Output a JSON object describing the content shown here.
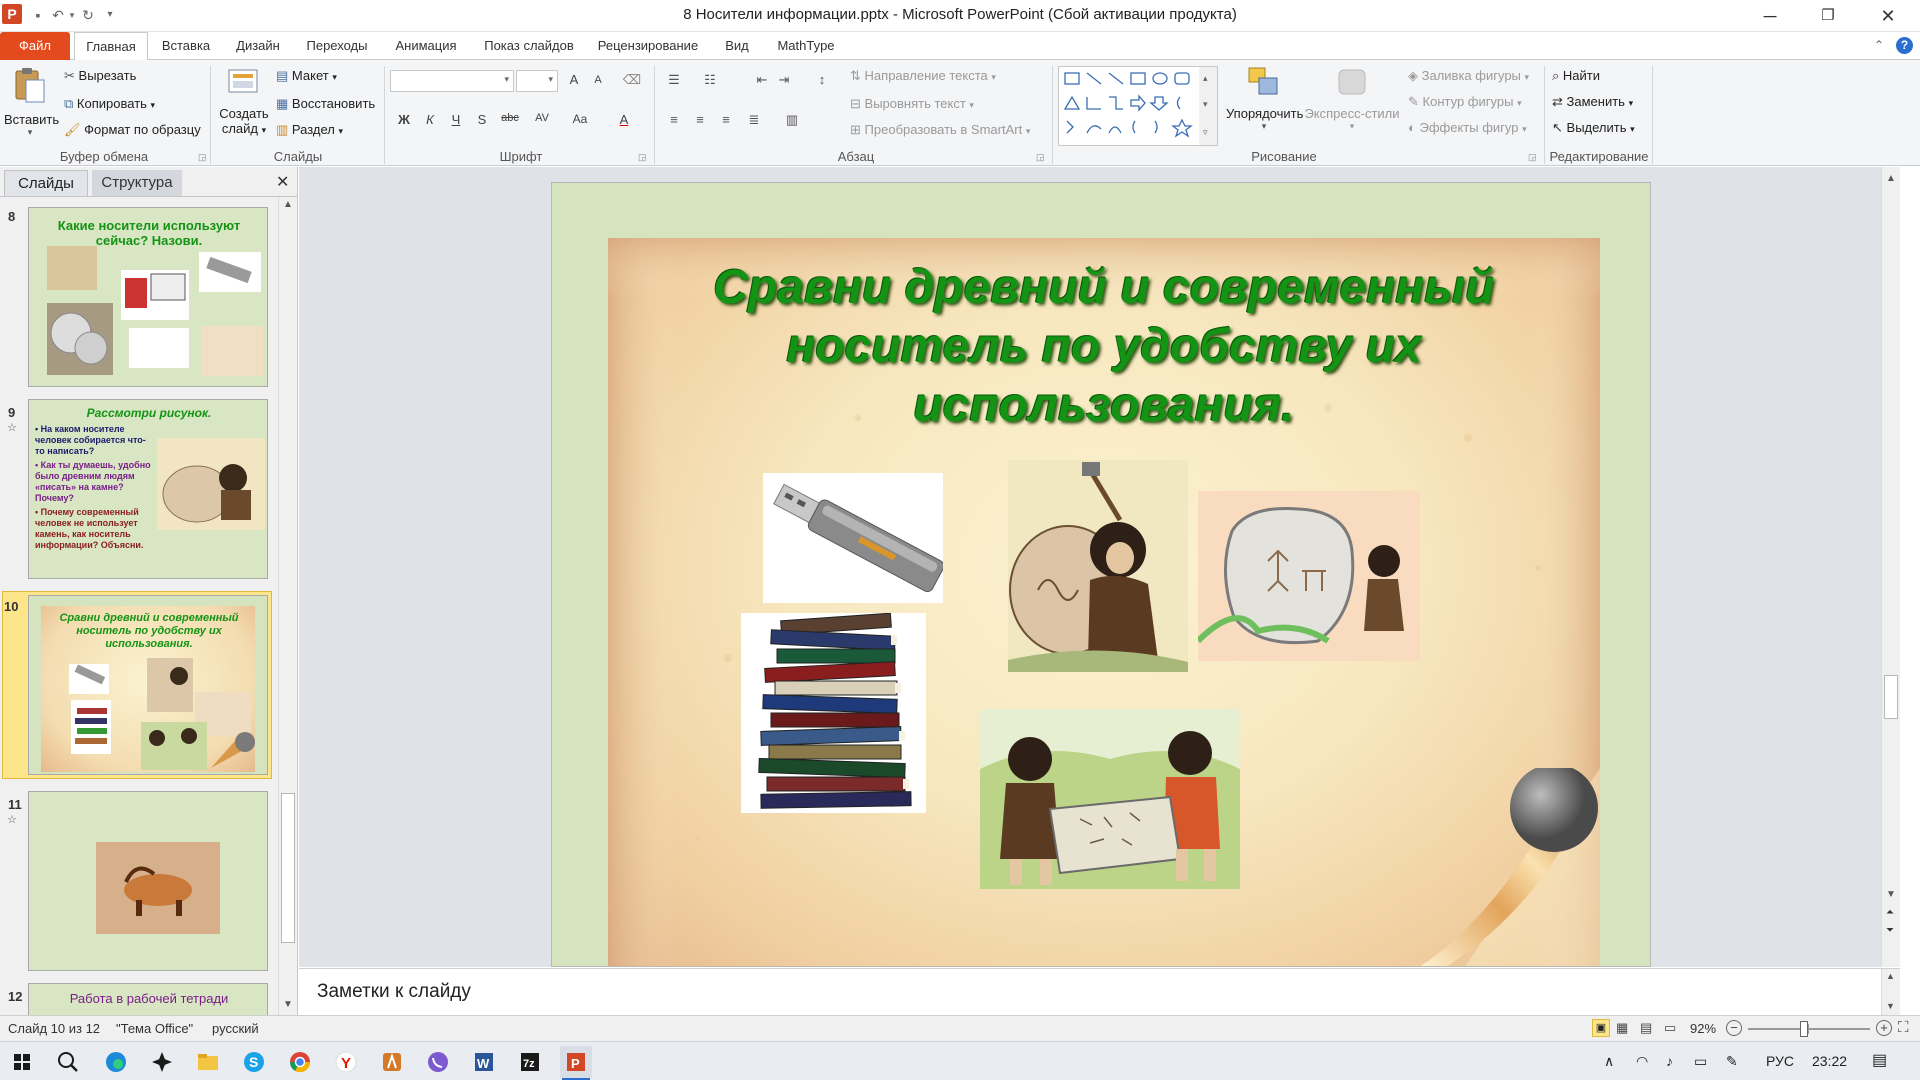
{
  "window": {
    "title": "8 Носители информации.pptx  -  Microsoft PowerPoint (Сбой активации продукта)",
    "app_icon_letter": "P"
  },
  "tabs": [
    {
      "label": "Файл"
    },
    {
      "label": "Главная"
    },
    {
      "label": "Вставка"
    },
    {
      "label": "Дизайн"
    },
    {
      "label": "Переходы"
    },
    {
      "label": "Анимация"
    },
    {
      "label": "Показ слайдов"
    },
    {
      "label": "Рецензирование"
    },
    {
      "label": "Вид"
    },
    {
      "label": "MathType"
    }
  ],
  "ribbon": {
    "clipboard": {
      "label": "Буфер обмена",
      "paste": "Вставить",
      "cut": "Вырезать",
      "copy": "Копировать",
      "format_painter": "Формат по образцу"
    },
    "slides": {
      "label": "Слайды",
      "new_slide_1": "Создать",
      "new_slide_2": "слайд",
      "layout": "Макет",
      "reset": "Восстановить",
      "section": "Раздел"
    },
    "font": {
      "label": "Шрифт",
      "buttons": [
        "Ж",
        "К",
        "Ч",
        "S",
        "abc",
        "AV",
        "Aa",
        "A"
      ],
      "grow": "A",
      "shrink": "A"
    },
    "paragraph": {
      "label": "Абзац",
      "text_direction": "Направление текста",
      "align_text": "Выровнять текст",
      "smartart": "Преобразовать в SmartArt"
    },
    "drawing": {
      "label": "Рисование",
      "arrange": "Упорядочить",
      "quick_styles": "Экспресс-стили",
      "shape_fill": "Заливка фигуры",
      "shape_outline": "Контур фигуры",
      "shape_effects": "Эффекты фигур"
    },
    "editing": {
      "label": "Редактирование",
      "find": "Найти",
      "replace": "Заменить",
      "select": "Выделить"
    }
  },
  "left_pane": {
    "tab_slides": "Слайды",
    "tab_outline": "Структура",
    "slides": [
      {
        "num": "8",
        "title": "Какие носители используют сейчас? Назови."
      },
      {
        "num": "9",
        "title": "Рассмотри  рисунок.",
        "bullets": [
          {
            "text": "На каком носителе человек собирается что- то написать?",
            "color": "#1b1b6b"
          },
          {
            "text": "Как ты думаешь, удобно было древним людям «писать» на камне? Почему?",
            "color": "#7a1e8a"
          },
          {
            "text": "Почему современный человек не использует камень, как носитель информации? Объясни.",
            "color": "#8a1e1e"
          }
        ]
      },
      {
        "num": "10",
        "title": "Сравни древний и современный носитель по удобству их использования."
      },
      {
        "num": "11"
      },
      {
        "num": "12",
        "title": "Работа в рабочей тетради"
      }
    ]
  },
  "slide": {
    "title": "Сравни древний и современный носитель по удобству их использования."
  },
  "notes": {
    "placeholder": "Заметки к слайду"
  },
  "status": {
    "slide_info": "Слайд 10 из 12",
    "theme": "\"Тема Office\"",
    "language": "русский",
    "zoom": "92%",
    "zoom_fraction": 0.46
  },
  "taskbar": {
    "lang": "РУС",
    "time": "23:22"
  },
  "colors": {
    "file_tab": "#e34b1e",
    "title_green": "#149414",
    "slide_bg": "#d5e3be",
    "selected_thumb": "#fde58a"
  }
}
